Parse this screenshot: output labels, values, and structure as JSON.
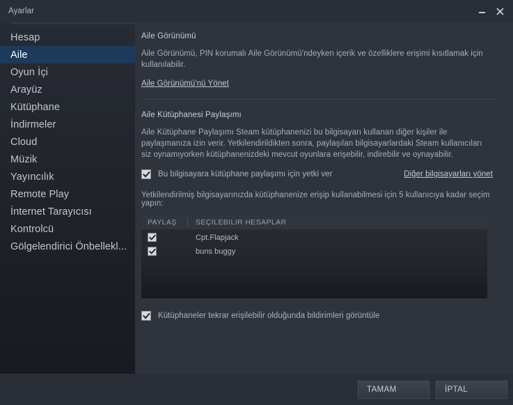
{
  "window": {
    "title": "Ayarlar",
    "controls": {
      "minimize": "minimize-icon",
      "close": "close-icon"
    }
  },
  "sidebar": {
    "items": [
      {
        "label": "Hesap",
        "selected": false
      },
      {
        "label": "Aile",
        "selected": true
      },
      {
        "label": "Oyun İçi",
        "selected": false
      },
      {
        "label": "Arayüz",
        "selected": false
      },
      {
        "label": "Kütüphane",
        "selected": false
      },
      {
        "label": "İndirmeler",
        "selected": false
      },
      {
        "label": "Cloud",
        "selected": false
      },
      {
        "label": "Müzik",
        "selected": false
      },
      {
        "label": "Yayıncılık",
        "selected": false
      },
      {
        "label": "Remote Play",
        "selected": false
      },
      {
        "label": "İnternet Tarayıcısı",
        "selected": false
      },
      {
        "label": "Kontrolcü",
        "selected": false
      },
      {
        "label": "Gölgelendirici Önbellekl...",
        "selected": false
      }
    ]
  },
  "family_view": {
    "title": "Aile Görünümü",
    "description": "Aile Görünümü, PIN korumalı Aile Görünümü'ndeyken içerik ve özelliklere erişimi kısıtlamak için kullanılabilir.",
    "manage_link": "Aile Görünümü'nü Yönet"
  },
  "library_sharing": {
    "title": "Aile Kütüphanesi Paylaşımı",
    "description": "Aile Kütüphane Paylaşımı Steam kütüphanenizi bu bilgisayarı kullanan diğer kişiler ile paylaşmanıza izin verir. Yetkilendirildikten sonra, paylaşılan bilgisayarlardaki Steam kullanıcıları siz oynamıyorken kütüphanenizdeki mevcut oyunlara erişebilir, indirebilir ve oynayabilir.",
    "authorize_checkbox": {
      "label": "Bu bilgisayara kütüphane paylaşımı için yetki ver",
      "checked": true
    },
    "manage_computers_link": "Diğer bilgisayarları yönet",
    "selection_hint": "Yetkilendirilmiş bilgisayarınızda kütüphanenize erişip kullanabilmesi için 5 kullanıcıya kadar seçim yapın:",
    "table": {
      "columns": [
        "PAYLAŞ",
        "SEÇILEBILIR HESAPLAR"
      ],
      "rows": [
        {
          "shared": true,
          "account": "Cpt.Flapjack"
        },
        {
          "shared": true,
          "account": "buns buggy"
        }
      ]
    },
    "notify_checkbox": {
      "label": "Kütüphaneler tekrar erişilebilir olduğunda bildirimleri görüntüle",
      "checked": true
    }
  },
  "footer": {
    "ok_label": "TAMAM",
    "cancel_label": "İPTAL"
  },
  "colors": {
    "selection": "#1b3a5c",
    "panel": "#2f333b",
    "titlebar": "#2a2e37",
    "text": "#a9aeb6"
  }
}
